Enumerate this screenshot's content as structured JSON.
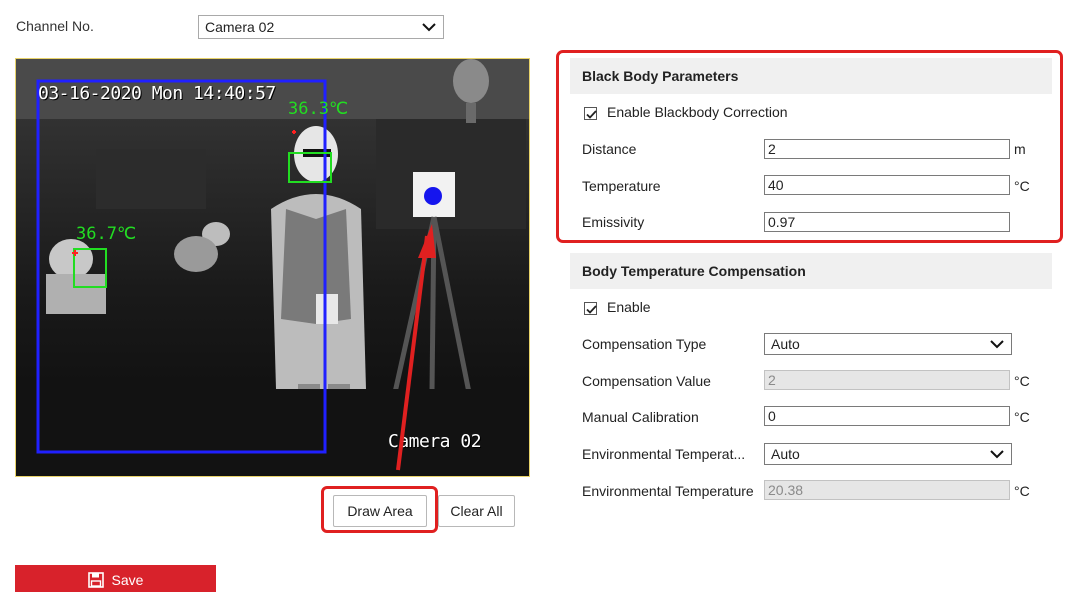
{
  "channel": {
    "label": "Channel No.",
    "selected": "Camera 02"
  },
  "video": {
    "osd_time": "03-16-2020 Mon 14:40:57",
    "osd_camera": "Camera 02",
    "temp_labels": [
      "36.3℃",
      "36.7℃"
    ]
  },
  "area_buttons": {
    "draw": "Draw Area",
    "clear": "Clear All"
  },
  "save": {
    "label": "Save"
  },
  "black_body": {
    "title": "Black Body Parameters",
    "enable_label": "Enable Blackbody Correction",
    "enable_checked": true,
    "distance_label": "Distance",
    "distance_value": "2",
    "distance_unit": "m",
    "temperature_label": "Temperature",
    "temperature_value": "40",
    "temperature_unit": "°C",
    "emissivity_label": "Emissivity",
    "emissivity_value": "0.97"
  },
  "body_comp": {
    "title": "Body Temperature Compensation",
    "enable_label": "Enable",
    "enable_checked": true,
    "comp_type_label": "Compensation Type",
    "comp_type_value": "Auto",
    "comp_value_label": "Compensation Value",
    "comp_value": "2",
    "comp_value_unit": "°C",
    "manual_cal_label": "Manual Calibration",
    "manual_cal_value": "0",
    "manual_cal_unit": "°C",
    "env_temp_mode_label": "Environmental Temperat...",
    "env_temp_mode_value": "Auto",
    "env_temp_label": "Environmental Temperature",
    "env_temp_value": "20.38",
    "env_temp_unit": "°C"
  },
  "colors": {
    "highlight": "#e02020",
    "save_button": "#d8222b",
    "detection_box": "#22dd22",
    "region_box": "#2020ff"
  },
  "icons": [
    "chevron-down-icon",
    "check-icon",
    "floppy-disk-icon"
  ]
}
